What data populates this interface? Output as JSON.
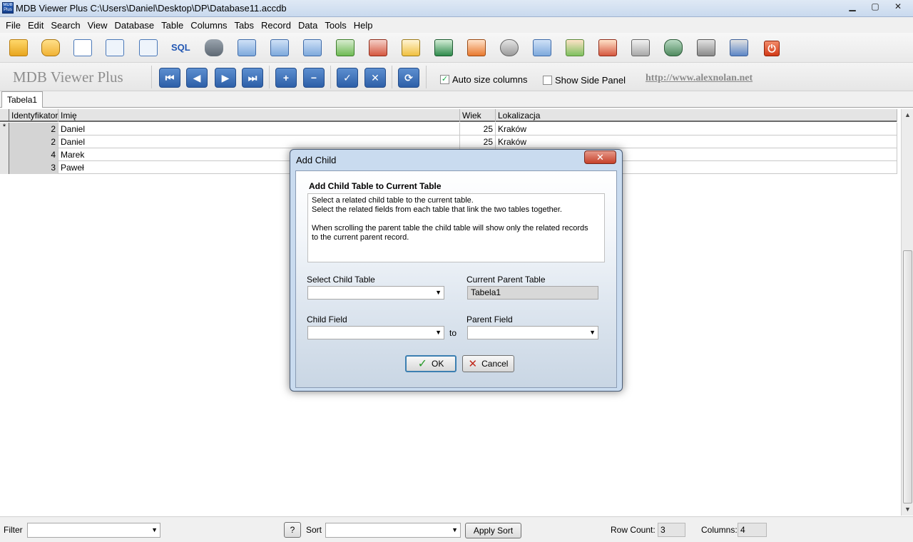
{
  "window": {
    "title": "MDB Viewer Plus C:\\Users\\Daniel\\Desktop\\DP\\Database11.accdb",
    "app_icon_text": "MDB Plus"
  },
  "menu": [
    "File",
    "Edit",
    "Search",
    "View",
    "Database",
    "Table",
    "Columns",
    "Tabs",
    "Record",
    "Data",
    "Tools",
    "Help"
  ],
  "toolbar1": {
    "sql_label": "SQL",
    "icons": [
      "open-folder-icon",
      "refresh-icon",
      "document-icon",
      "zoom-icon",
      "search-icon",
      "sql-icon",
      "database-add-icon",
      "table-icon",
      "columns-icon",
      "table-info-icon",
      "table-add-icon",
      "table-remove-icon",
      "table-edit-icon",
      "rename-icon",
      "table-link-icon",
      "settings-icon",
      "table-split-icon",
      "table-relation-add-icon",
      "table-relation-remove-icon",
      "print-icon",
      "database-icon",
      "import-icon",
      "export-icon",
      "power-icon"
    ]
  },
  "toolbar2": {
    "brand": "MDB Viewer Plus",
    "nav": {
      "first": "⏮",
      "prev": "◀",
      "next": "▶",
      "last": "⏭",
      "add": "+",
      "remove": "−",
      "post": "✓",
      "cancel": "✕",
      "refresh": "⟳"
    },
    "auto_size_label": "Auto size columns",
    "auto_size_checked": true,
    "side_panel_label": "Show Side Panel",
    "side_panel_checked": false,
    "link": "http://www.alexnolan.net"
  },
  "tabs": [
    "Tabela1"
  ],
  "grid": {
    "headers": [
      "Identyfikator",
      "Imię",
      "Wiek",
      "Lokalizacja"
    ],
    "rows": [
      {
        "marker": "*",
        "id": "2",
        "name": "Daniel",
        "age": "25",
        "loc": "Kraków"
      },
      {
        "marker": "",
        "id": "2",
        "name": "Daniel",
        "age": "25",
        "loc": "Kraków"
      },
      {
        "marker": "",
        "id": "4",
        "name": "Marek",
        "age": "",
        "loc": ""
      },
      {
        "marker": "",
        "id": "3",
        "name": "Paweł",
        "age": "",
        "loc": ""
      }
    ]
  },
  "status": {
    "filter_label": "Filter",
    "filter_value": "",
    "help_button": "?",
    "sort_label": "Sort",
    "sort_value": "",
    "apply_sort": "Apply Sort",
    "row_count_label": "Row Count:",
    "row_count": "3",
    "columns_label": "Columns:",
    "columns": "4"
  },
  "dialog": {
    "title": "Add Child",
    "close": "✕",
    "heading": "Add Child Table to Current Table",
    "desc": [
      "Select a related child table to the current table.",
      "Select the related fields from each table that link the two tables together.",
      "",
      "When scrolling the parent table the child table will show only the related records",
      "to the current parent record."
    ],
    "select_child_label": "Select Child Table",
    "select_child_value": "",
    "parent_table_label": "Current Parent Table",
    "parent_table_value": "Tabela1",
    "child_field_label": "Child Field",
    "child_field_value": "",
    "to_label": "to",
    "parent_field_label": "Parent Field",
    "parent_field_value": "",
    "ok": "OK",
    "cancel": "Cancel"
  },
  "colors": {
    "accent": "#2d5fa8",
    "dialog_frame": "#c9dbef"
  }
}
